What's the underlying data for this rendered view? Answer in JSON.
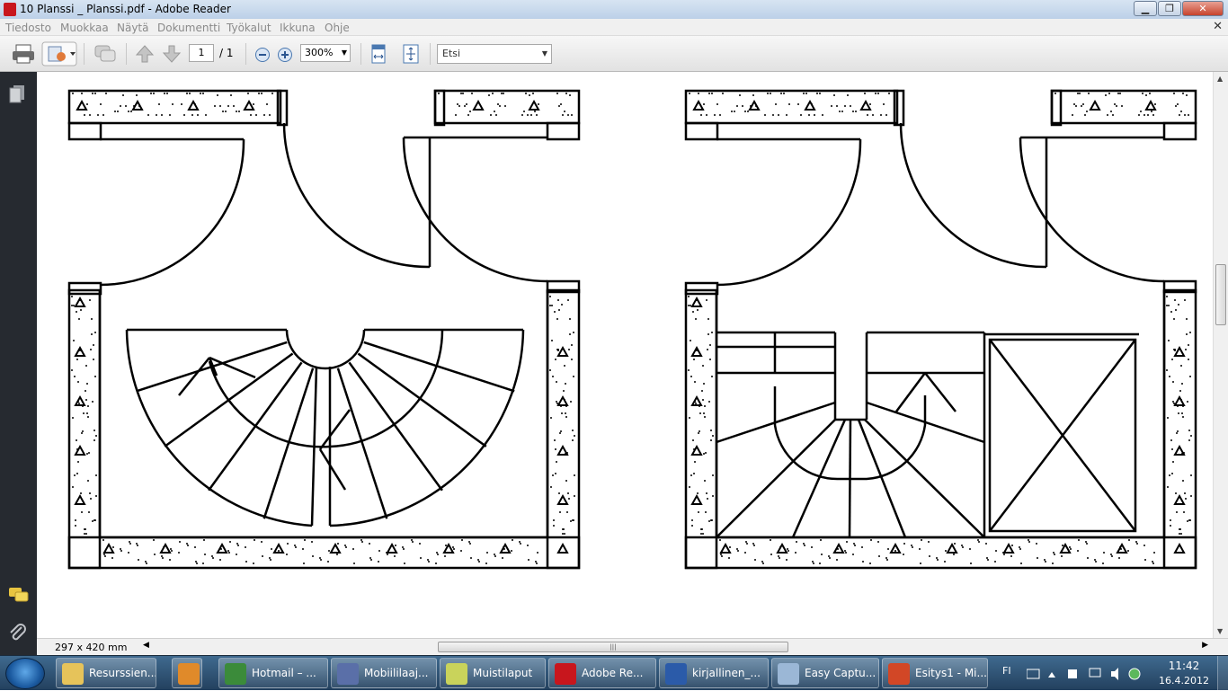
{
  "window": {
    "title": "10 Planssi _ Planssi.pdf - Adobe Reader",
    "minimize_glyph": "▁",
    "maximize_glyph": "❐",
    "close_glyph": "✕"
  },
  "menu": {
    "items": [
      "Tiedosto",
      "Muokkaa",
      "Näytä",
      "Dokumentti",
      "Työkalut",
      "Ikkuna",
      "Ohje"
    ],
    "close_glyph": "✕"
  },
  "toolbar": {
    "current_page": "1",
    "total_pages": "/ 1",
    "zoom": "300%",
    "search_placeholder": "Etsi",
    "icons": [
      "print-icon",
      "export-icon",
      "comment-icon",
      "prev-page-icon",
      "next-page-icon",
      "zoom-out-icon",
      "zoom-in-icon",
      "fit-width-icon",
      "fit-page-icon"
    ]
  },
  "status": {
    "page_size": "297 x 420 mm"
  },
  "taskbar": {
    "items": [
      {
        "label": "Resurssien...",
        "color": "#e6c35a"
      },
      {
        "label": "",
        "color": "#e08a2a"
      },
      {
        "label": "Hotmail – ...",
        "color": "#3b8b3a"
      },
      {
        "label": "Mobiililaaj...",
        "color": "#5a6fa8"
      },
      {
        "label": "Muistilaput",
        "color": "#c9d35b"
      },
      {
        "label": "Adobe Re...",
        "color": "#c8161d"
      },
      {
        "label": "kirjallinen_...",
        "color": "#2b5ba9"
      },
      {
        "label": "Easy Captu...",
        "color": "#9bb7d6"
      },
      {
        "label": "Esitys1 - Mi...",
        "color": "#d24726"
      }
    ],
    "language": "FI",
    "time": "11:42",
    "date": "16.4.2012"
  },
  "colors": {
    "title_bar": "#c6d7ec",
    "left_panel": "#262a30",
    "taskbar": "#2d5073"
  }
}
